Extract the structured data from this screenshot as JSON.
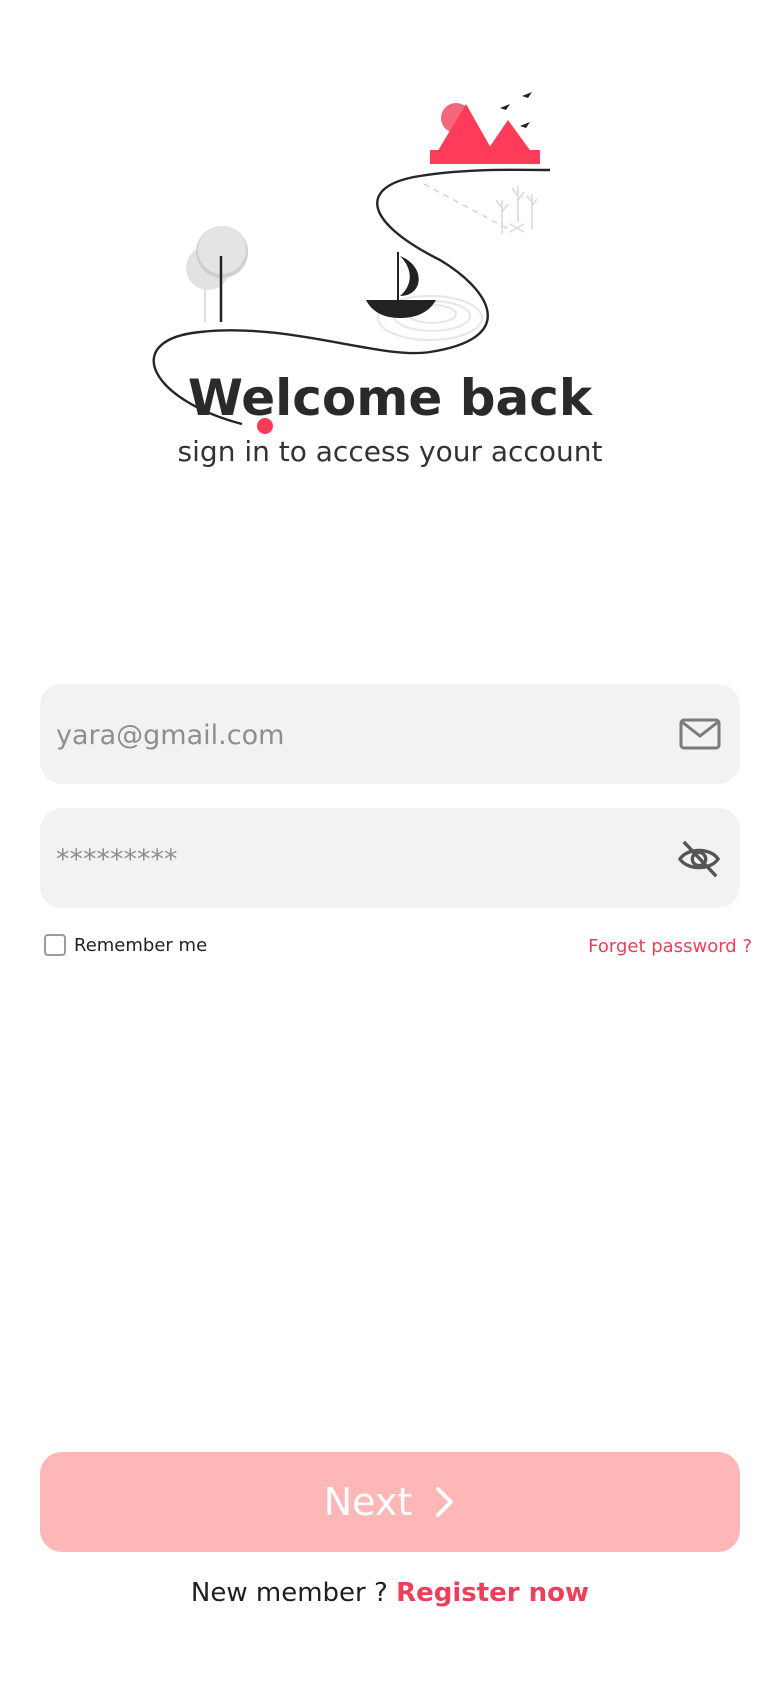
{
  "welcome": {
    "title": "Welcome back",
    "subtitle": "sign in to access your account"
  },
  "form": {
    "email_placeholder": "yara@gmail.com",
    "email_icon": "mail-icon",
    "password_placeholder": "*********",
    "password_icon": "eye-off-icon",
    "remember_label": "Remember me",
    "remember_checked": false,
    "forget_label": "Forget password ?"
  },
  "actions": {
    "next_label": "Next",
    "next_icon": "chevron-right-icon",
    "new_member_text": "New member ?",
    "register_label": "Register now"
  },
  "colors": {
    "accent": "#ee3e5a",
    "button_bg": "#fdb7b7",
    "field_bg": "#f2f2f2",
    "title": "#2a2a2a"
  }
}
